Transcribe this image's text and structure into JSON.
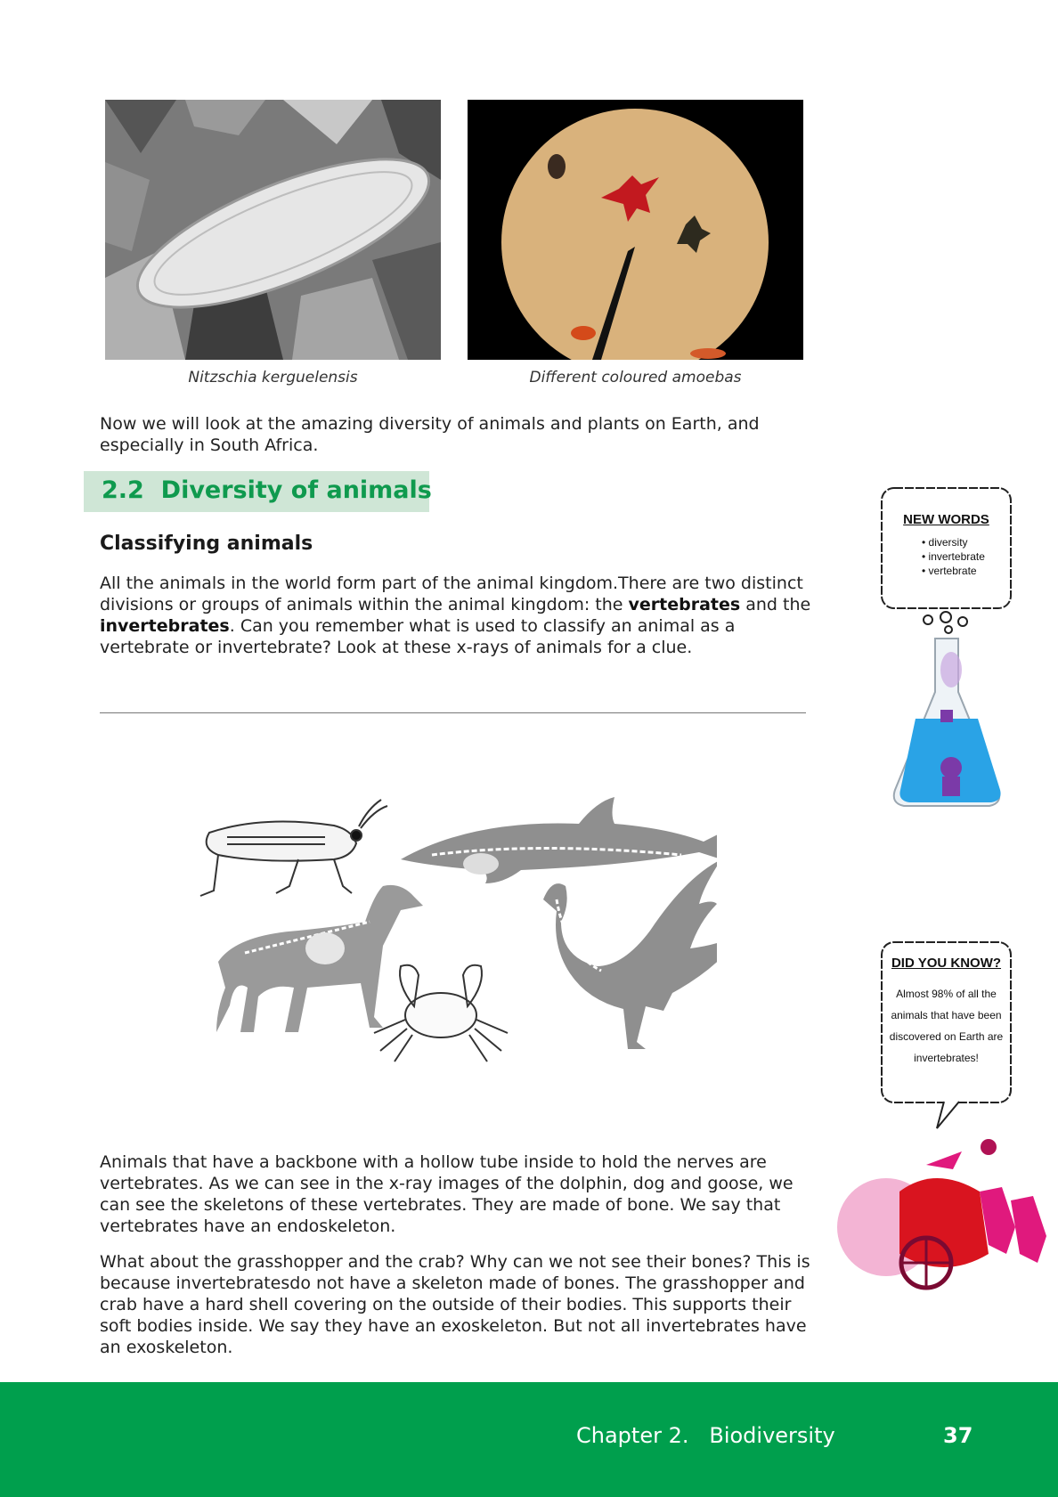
{
  "photos": {
    "left_caption": "Nitzschia kerguelensis",
    "right_caption": "Different coloured amoebas"
  },
  "intro": "Now we will look at the amazing diversity of animals and plants on Earth, and especially in South Africa.",
  "section": {
    "number": "2.2",
    "title": "Diversity of animals"
  },
  "subheading": "Classifying animals",
  "body1": {
    "part1": "All the animals in the world form part of the animal kingdom.There are two distinct divisions or groups of animals within the animal kingdom: the ",
    "bold1": "vertebrates",
    "part2": " and the ",
    "bold2": "invertebrates",
    "part3": ". Can you remember what is used to classify an animal as a vertebrate or invertebrate? Look at these x-rays of animals for a clue."
  },
  "body2": "Animals that have a backbone with a hollow tube inside to hold the nerves are vertebrates. As we can see in the x-ray images of the dolphin, dog and goose, we can see the skeletons of these vertebrates. They are made of bone. We say that vertebrates have an endoskeleton.",
  "body3": "What about the grasshopper and the crab? Why can we not see their bones? This is because invertebratesdo not have a skeleton made of bones. The grasshopper and crab have a hard shell covering on the outside of their bodies. This supports their soft bodies inside. We say they have an exoskeleton. But not all invertebrates have an exoskeleton.",
  "new_words": {
    "title": "NEW WORDS",
    "items": [
      "diversity",
      "invertebrate",
      "vertebrate"
    ]
  },
  "did_you_know": {
    "title": "DID YOU KNOW?",
    "lines": [
      "Almost 98% of all the",
      "animals that have been",
      "discovered on Earth are",
      "invertebrates!"
    ]
  },
  "footer": {
    "chapter": "Chapter 2.   Biodiversity",
    "page": "37"
  },
  "colors": {
    "green": "#009f4d",
    "section_bg": "#cfe6d6",
    "section_text": "#0f9a4e"
  }
}
